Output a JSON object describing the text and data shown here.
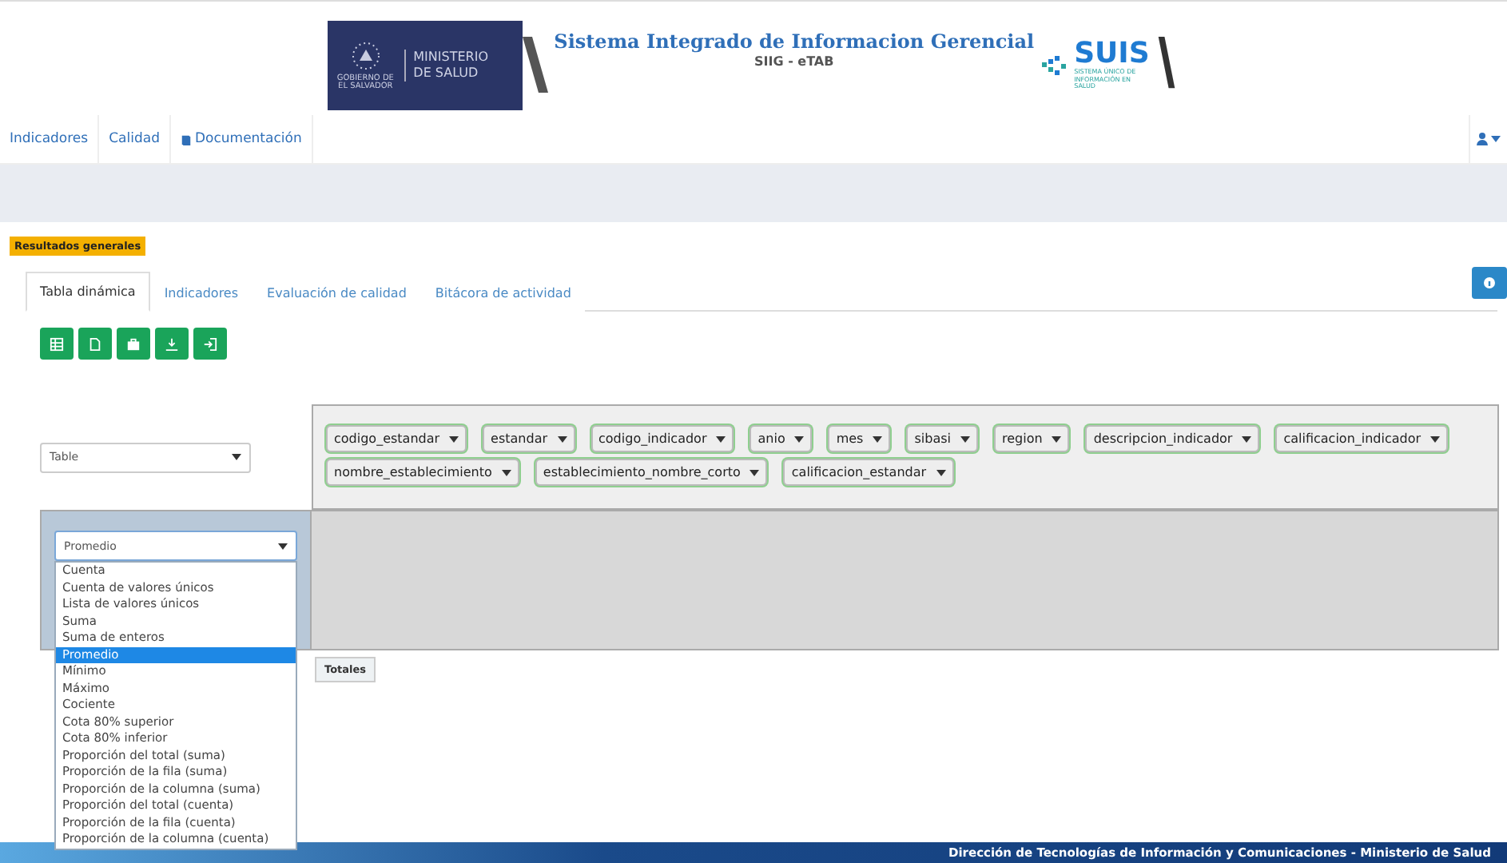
{
  "header": {
    "ministry": {
      "line1": "MINISTERIO",
      "line2": "DE SALUD",
      "government": "GOBIERNO DE EL SALVADOR"
    },
    "title": "Sistema Integrado de Informacion Gerencial",
    "subtitle": "SIIG - eTAB",
    "suis": {
      "name": "SUIS",
      "tagline": "SISTEMA ÚNICO DE INFORMACIÓN EN SALUD"
    }
  },
  "nav": [
    {
      "label": "Indicadores",
      "has_icon": false
    },
    {
      "label": "Calidad",
      "has_icon": false
    },
    {
      "label": "Documentación",
      "has_icon": true
    }
  ],
  "section_label": "Resultados generales",
  "tabs": [
    {
      "label": "Tabla dinámica",
      "selected": true
    },
    {
      "label": "Indicadores",
      "selected": false
    },
    {
      "label": "Evaluación de calidad",
      "selected": false
    },
    {
      "label": "Bitácora de actividad",
      "selected": false
    }
  ],
  "pivot": {
    "renderer": "Table",
    "attributes": [
      "codigo_estandar",
      "estandar",
      "codigo_indicador",
      "anio",
      "mes",
      "sibasi",
      "region",
      "descripcion_indicador",
      "calificacion_indicador",
      "nombre_establecimiento",
      "establecimiento_nombre_corto",
      "calificacion_estandar"
    ],
    "aggregator": {
      "value": "Promedio",
      "open": true,
      "options": [
        {
          "label": "Cuenta",
          "selected": false
        },
        {
          "label": "Cuenta de valores únicos",
          "selected": false
        },
        {
          "label": "Lista de valores únicos",
          "selected": false
        },
        {
          "label": "Suma",
          "selected": false
        },
        {
          "label": "Suma de enteros",
          "selected": false
        },
        {
          "label": "Promedio",
          "selected": true
        },
        {
          "label": "Mínimo",
          "selected": false
        },
        {
          "label": "Máximo",
          "selected": false
        },
        {
          "label": "Cociente",
          "selected": false
        },
        {
          "label": "Cota 80% superior",
          "selected": false
        },
        {
          "label": "Cota 80% inferior",
          "selected": false
        },
        {
          "label": "Proporción del total (suma)",
          "selected": false
        },
        {
          "label": "Proporción de la fila (suma)",
          "selected": false
        },
        {
          "label": "Proporción de la columna (suma)",
          "selected": false
        },
        {
          "label": "Proporción del total (cuenta)",
          "selected": false
        },
        {
          "label": "Proporción de la fila (cuenta)",
          "selected": false
        },
        {
          "label": "Proporción de la columna (cuenta)",
          "selected": false
        }
      ]
    },
    "totals": "Totales"
  },
  "footer": "Dirección de Tecnologías de Información y Comunicaciones - Ministerio de Salud"
}
